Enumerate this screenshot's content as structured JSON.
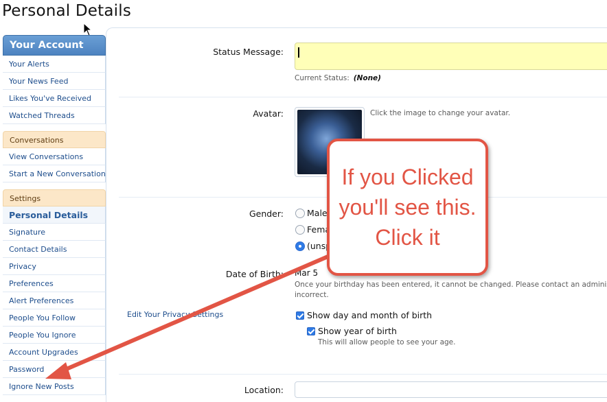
{
  "page": {
    "title": "Personal Details"
  },
  "sidebar": {
    "account_header": "Your Account",
    "account_items": [
      {
        "label": "Your Alerts"
      },
      {
        "label": "Your News Feed"
      },
      {
        "label": "Likes You've Received"
      },
      {
        "label": "Watched Threads"
      }
    ],
    "conversations_header": "Conversations",
    "conversation_items": [
      {
        "label": "View Conversations"
      },
      {
        "label": "Start a New Conversation"
      }
    ],
    "settings_header": "Settings",
    "settings_items": [
      {
        "label": "Personal Details",
        "active": true
      },
      {
        "label": "Signature"
      },
      {
        "label": "Contact Details"
      },
      {
        "label": "Privacy"
      },
      {
        "label": "Preferences"
      },
      {
        "label": "Alert Preferences"
      },
      {
        "label": "People You Follow"
      },
      {
        "label": "People You Ignore"
      },
      {
        "label": "Account Upgrades"
      },
      {
        "label": "Password"
      },
      {
        "label": "Ignore New Posts"
      }
    ]
  },
  "form": {
    "status_label": "Status Message:",
    "status_value": "",
    "current_status_label": "Current Status:",
    "current_status_value": "(None)",
    "avatar_label": "Avatar:",
    "avatar_hint": "Click the image to change your avatar.",
    "gender_label": "Gender:",
    "gender_options": [
      "Male",
      "Fema",
      "(unsp"
    ],
    "gender_selected": "(unsp",
    "dob_label": "Date of Birth:",
    "dob_value": "Mar 5",
    "dob_note_line1": "Once your birthday has been entered, it cannot be changed. Please contact an administrator",
    "dob_note_line2": "incorrect.",
    "privacy_link": "Edit Your Privacy Settings",
    "show_day_month": "Show day and month of birth",
    "show_year": "Show year of birth",
    "show_year_hint": "This will allow people to see your age.",
    "location_label": "Location:",
    "location_value": ""
  },
  "callout": {
    "text": "If you Clicked you'll see this. Click it"
  },
  "colors": {
    "callout": "#e25545",
    "nav_header": "#4d83c0",
    "nav_section": "#fce7c8",
    "link": "#1d4d8c",
    "status_input_bg": "#ffffb8"
  }
}
